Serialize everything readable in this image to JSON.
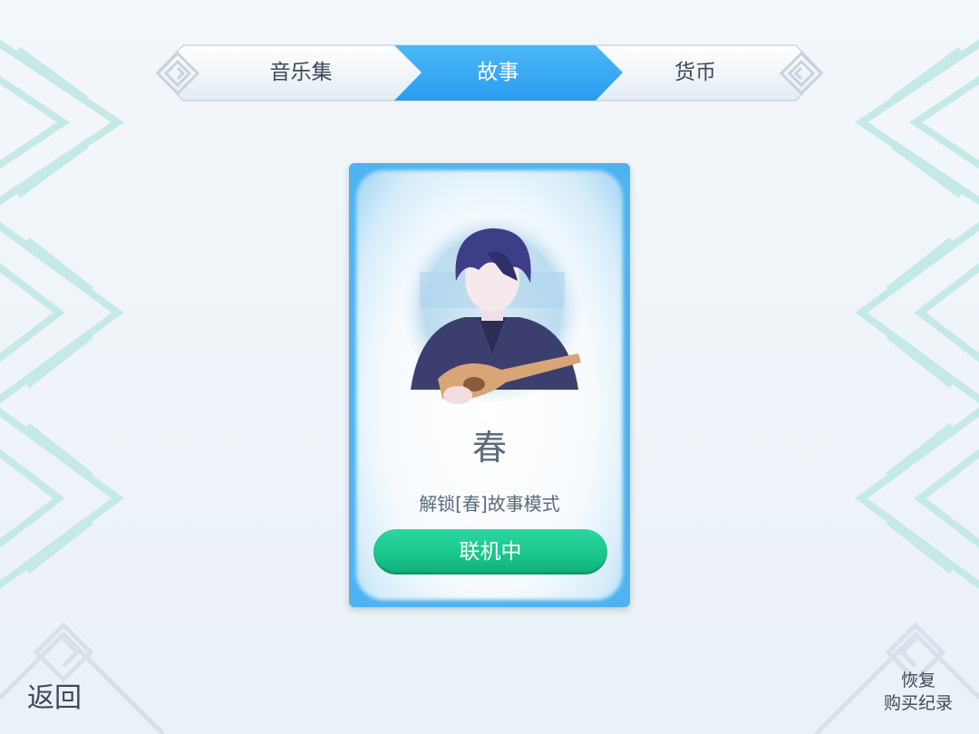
{
  "tabs": {
    "music_label": "音乐集",
    "story_label": "故事",
    "currency_label": "货币",
    "active": "story"
  },
  "card": {
    "title": "春",
    "description": "解锁[春]故事模式",
    "button_label": "联机中",
    "portrait_icon": "guitarist-portrait-icon"
  },
  "footer": {
    "back_label": "返回",
    "restore_line1": "恢复",
    "restore_line2": "购买纪录"
  },
  "colors": {
    "active_tab": "#36a9f4",
    "card_frame": "#4db4f1",
    "button_green": "#1cc98d",
    "lattice": "#bfe7e6"
  }
}
